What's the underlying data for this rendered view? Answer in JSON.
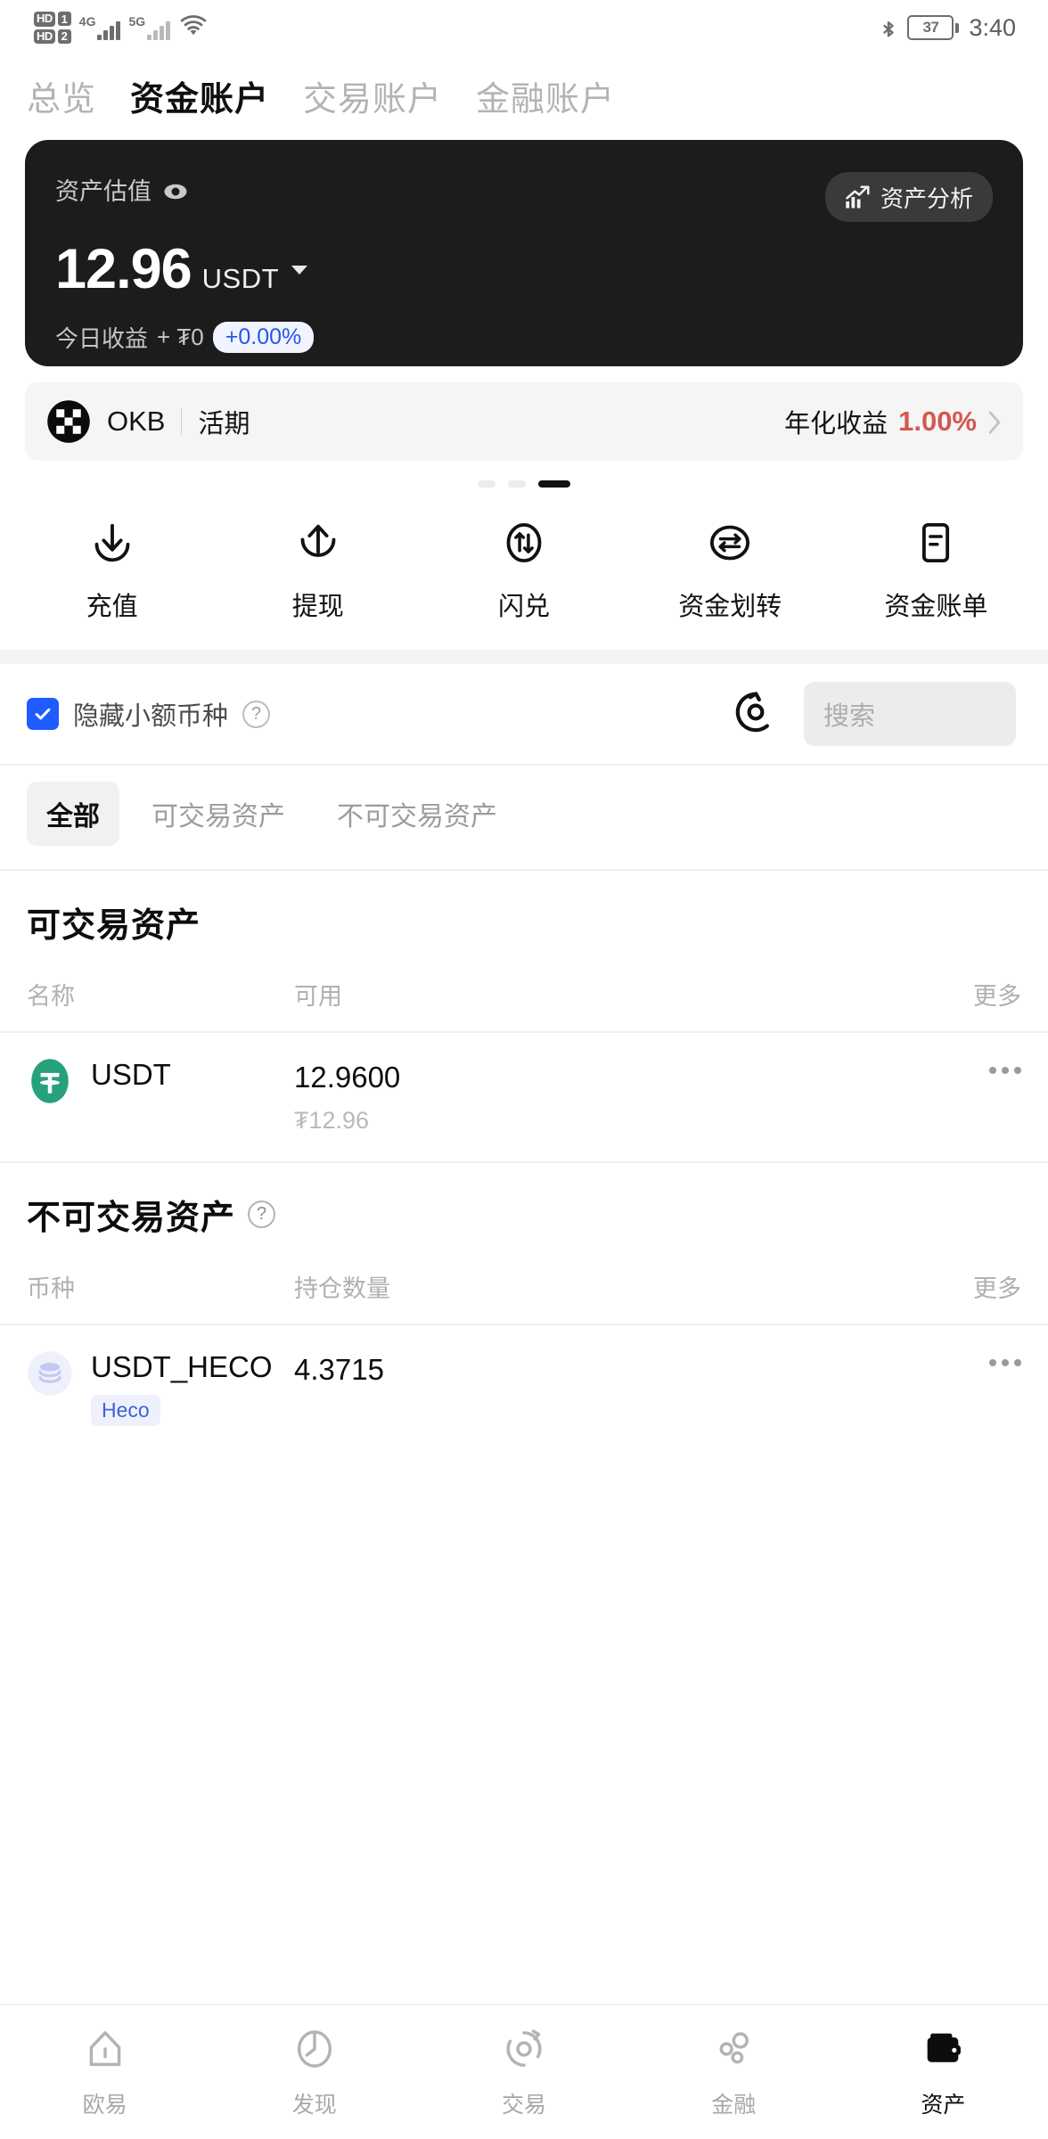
{
  "status_bar": {
    "hd1": "HD",
    "hd1_num": "1",
    "hd2": "HD",
    "hd2_num": "2",
    "net1": "4G",
    "net2": "5G",
    "wifi_icon": "wifi-icon",
    "bluetooth_icon": "bluetooth-icon",
    "battery_level": "37",
    "time": "3:40"
  },
  "top_tabs": [
    {
      "label": "总览",
      "active": false
    },
    {
      "label": "资金账户",
      "active": true
    },
    {
      "label": "交易账户",
      "active": false
    },
    {
      "label": "金融账户",
      "active": false
    }
  ],
  "hero": {
    "label": "资产估值",
    "eye_icon": "eye-icon",
    "analysis_button": "资产分析",
    "analysis_icon": "chart-trend-icon",
    "amount": "12.96",
    "unit": "USDT",
    "caret_icon": "chevron-down-icon",
    "profit_label": "今日收益",
    "profit_value": "+ ₮0",
    "profit_percent": "+0.00%"
  },
  "okb_banner": {
    "logo_icon": "okb-logo-icon",
    "name": "OKB",
    "sub": "活期",
    "rate_label": "年化收益",
    "rate_value": "1.00%",
    "chevron_icon": "chevron-right-icon",
    "dots_total": 3,
    "dots_active_index": 2
  },
  "actions": [
    {
      "label": "充值",
      "icon": "deposit-arrow-down-icon"
    },
    {
      "label": "提现",
      "icon": "withdraw-arrow-up-icon"
    },
    {
      "label": "闪兑",
      "icon": "flash-swap-icon"
    },
    {
      "label": "资金划转",
      "icon": "transfer-icon"
    },
    {
      "label": "资金账单",
      "icon": "bill-document-icon"
    }
  ],
  "filter_row": {
    "checkbox_checked": true,
    "checkbox_icon": "checkmark-icon",
    "hide_small_label": "隐藏小额币种",
    "help_icon": "question-mark-icon",
    "refresh_icon": "refresh-icon",
    "search_placeholder": "搜索",
    "search_value": ""
  },
  "chips": [
    {
      "label": "全部",
      "active": true
    },
    {
      "label": "可交易资产",
      "active": false
    },
    {
      "label": "不可交易资产",
      "active": false
    }
  ],
  "tradable_section": {
    "title": "可交易资产",
    "columns": [
      "名称",
      "可用",
      "更多"
    ],
    "rows": [
      {
        "icon": "usdt-tether-icon",
        "name": "USDT",
        "chain": "",
        "available": "12.9600",
        "fiat": "₮12.96",
        "more_icon": "more-dots-icon"
      }
    ]
  },
  "non_tradable_section": {
    "title": "不可交易资产",
    "help_icon": "question-mark-icon",
    "columns": [
      "币种",
      "持仓数量",
      "更多"
    ],
    "rows": [
      {
        "icon": "heco-stack-icon",
        "name": "USDT_HECO",
        "chain": "Heco",
        "available": "4.3715",
        "fiat": "",
        "more_icon": "more-dots-icon"
      }
    ]
  },
  "bottom_nav": [
    {
      "label": "欧易",
      "icon": "home-icon",
      "active": false
    },
    {
      "label": "发现",
      "icon": "discover-icon",
      "active": false
    },
    {
      "label": "交易",
      "icon": "trade-icon",
      "active": false
    },
    {
      "label": "金融",
      "icon": "finance-icon",
      "active": false
    },
    {
      "label": "资产",
      "icon": "wallet-icon",
      "active": true
    }
  ],
  "colors": {
    "hero_bg": "#1c1c1c",
    "accent_blue": "#2358e6",
    "rate_red": "#d4584f",
    "checkbox_blue": "#1f5bff",
    "usdt_green": "#26a17b",
    "chain_badge_text": "#3e63d8"
  }
}
